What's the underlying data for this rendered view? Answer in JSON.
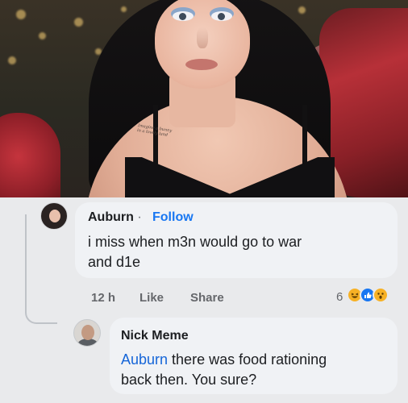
{
  "photo": {
    "tattoo_line1": "Imagine a bunny",
    "tattoo_line2": "in a  lovely land"
  },
  "comments": [
    {
      "author": "Auburn",
      "separator": "·",
      "follow_label": "Follow",
      "text_line1": "i miss when m3n would go to war",
      "text_line2": "and d1e",
      "time": "12 h",
      "like_label": "Like",
      "share_label": "Share",
      "reaction_count": "6",
      "reactions": [
        "haha-icon",
        "like-icon",
        "wow-icon"
      ]
    },
    {
      "author": "Nick Meme",
      "mention": "Auburn",
      "text_line1_rest": " there was food rationing",
      "text_line2": "back then. You sure?"
    }
  ],
  "colors": {
    "link": "#1877f2",
    "bubble": "#f0f2f5",
    "meta": "#65676b"
  }
}
